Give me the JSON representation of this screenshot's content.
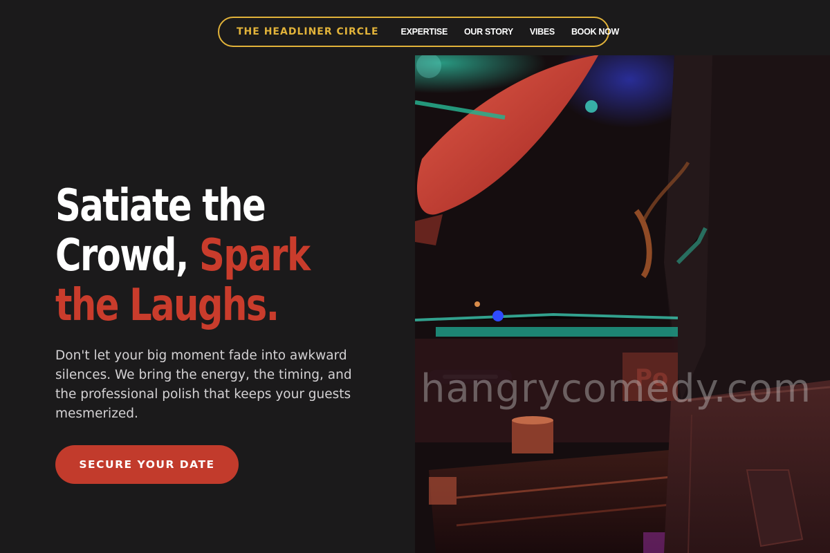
{
  "nav": {
    "brand": "THE HEADLINER CIRCLE",
    "links": [
      "EXPERTISE",
      "OUR STORY",
      "VIBES",
      "BOOK NOW"
    ]
  },
  "hero": {
    "title_line_1": "Satiate the",
    "title_line_2_white": "Crowd, ",
    "title_line_2_accent": "Spark",
    "title_line_3_accent": "the Laughs.",
    "description": "Don't let your big moment fade into awkward silences. We bring the energy, the timing, and the professional polish that keeps your guests mesmerized.",
    "cta_label": "SECURE YOUR DATE"
  },
  "photo": {
    "watermark": "hangrycomedy.com"
  },
  "colors": {
    "background": "#1b1a1b",
    "brand_gold": "#e2b33a",
    "accent_red": "#c93c2c",
    "button_red": "#c23b2c",
    "text_white": "#ffffff",
    "text_muted": "#d4d2d4"
  }
}
